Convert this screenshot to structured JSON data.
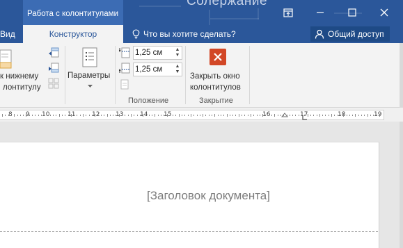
{
  "titlebar": {
    "context_group": "Работа с колонтитулами",
    "doc_title_fragment": "Солержание",
    "window_buttons": [
      "ribbon-display-icon",
      "minimize-icon",
      "maximize-icon",
      "close-icon"
    ]
  },
  "tabs": {
    "view": "Вид",
    "designer": "Конструктор",
    "tell_me": "Что вы хотите сделать?",
    "share": "Общий доступ"
  },
  "ribbon": {
    "navigation": {
      "goto_footer_line1": "к нижнему",
      "goto_footer_line2": "лонтитулу"
    },
    "params_label": "Параметры",
    "position": {
      "header_value": "1,25 см",
      "footer_value": "1,25 см",
      "label": "Положение"
    },
    "close": {
      "button_line1": "Закрыть окно",
      "button_line2": "колонтитулов",
      "label": "Закрытие"
    }
  },
  "ruler": {
    "numbers": [
      "8",
      "9",
      "10",
      "11",
      "12",
      "13",
      "14",
      "15",
      "16",
      "17",
      "18",
      "19"
    ]
  },
  "document": {
    "heading_placeholder": "[Заголовок документа]"
  },
  "colors": {
    "accent": "#2b579a",
    "close_red": "#d24726"
  }
}
